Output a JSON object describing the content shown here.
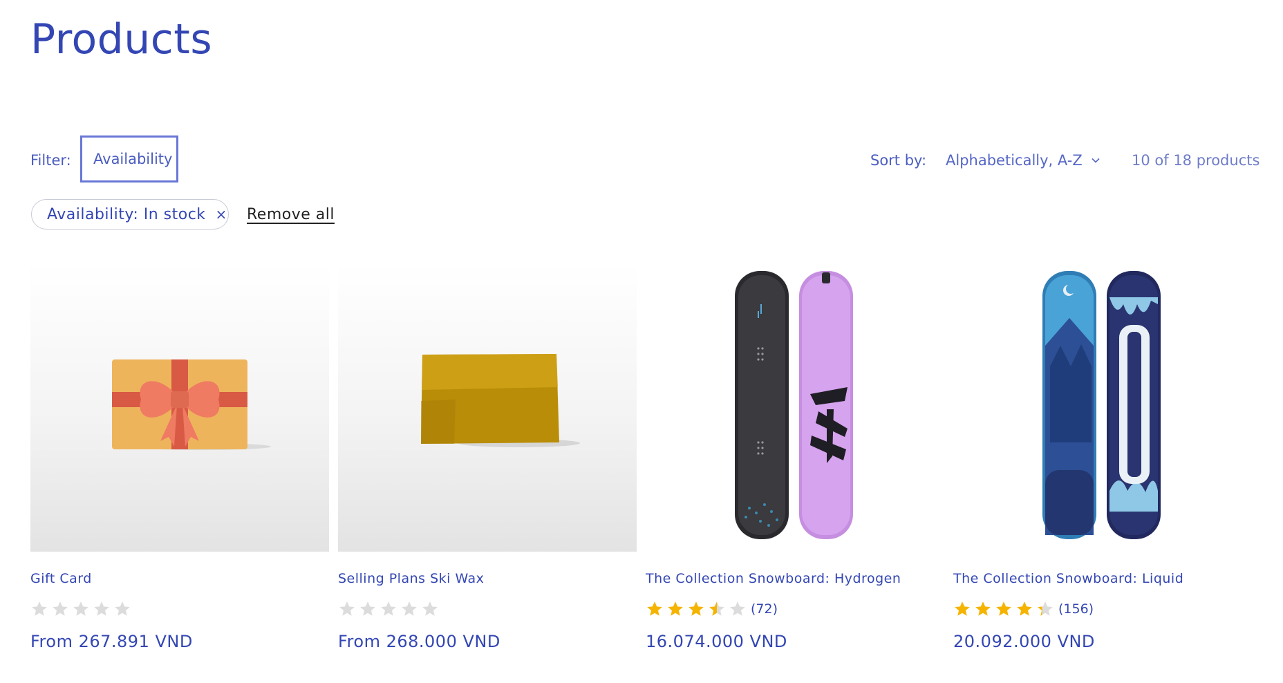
{
  "page": {
    "title": "Products"
  },
  "toolbar": {
    "filter_label": "Filter:",
    "filter_button": "Availability",
    "sort_label": "Sort by:",
    "sort_value": "Alphabetically, A-Z",
    "product_count": "10 of 18 products"
  },
  "active_filters": {
    "chip": "Availability: In stock",
    "chip_remove": "×",
    "remove_all": "Remove all"
  },
  "products": [
    {
      "name": "Gift Card",
      "rating": 0,
      "review_count": "",
      "price": "From 267.891 VND",
      "image": "gift-card-image"
    },
    {
      "name": "Selling Plans Ski Wax",
      "rating": 0,
      "review_count": "",
      "price": "From 268.000 VND",
      "image": "ski-wax-image"
    },
    {
      "name": "The Collection Snowboard: Hydrogen",
      "rating": 3.5,
      "review_count": "(72)",
      "price": "16.074.000 VND",
      "image": "hydrogen-snowboard-image"
    },
    {
      "name": "The Collection Snowboard: Liquid",
      "rating": 4.3,
      "review_count": "(156)",
      "price": "20.092.000 VND",
      "image": "liquid-snowboard-image"
    }
  ],
  "colors": {
    "accent": "#3346b3",
    "star_filled": "#f5b400",
    "star_empty": "#dcdcdc"
  }
}
